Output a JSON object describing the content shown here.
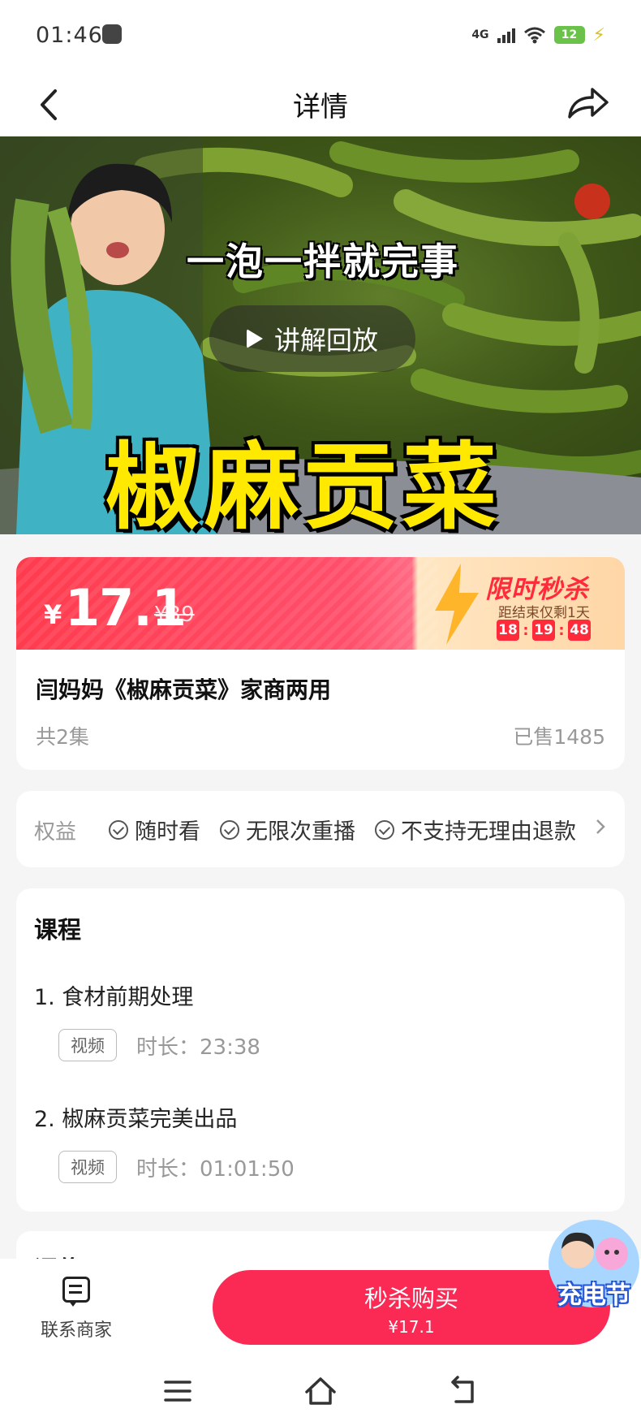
{
  "status_bar": {
    "time": "01:46",
    "network": "4G",
    "battery": "12"
  },
  "nav": {
    "title": "详情"
  },
  "video": {
    "caption": "一泡一拌就完事",
    "title_overlay": "椒麻贡菜",
    "replay_label": "讲解回放"
  },
  "price": {
    "currency": "¥",
    "current": "17.1",
    "original": "¥39",
    "flash_title": "限时秒杀",
    "flash_sub": "距结束仅剩1天",
    "countdown": {
      "h": "18",
      "m": "19",
      "s": "48"
    }
  },
  "product": {
    "title": "闫妈妈《椒麻贡菜》家商两用",
    "episodes": "共2集",
    "sold": "已售1485"
  },
  "benefits": {
    "label": "权益",
    "items": [
      "随时看",
      "无限次重播",
      "不支持无理由退款"
    ]
  },
  "course": {
    "heading": "课程",
    "lessons": [
      {
        "title": "1. 食材前期处理",
        "tag": "视频",
        "duration": "时长：23:38"
      },
      {
        "title": "2. 椒麻贡菜完美出品",
        "tag": "视频",
        "duration": "时长：01:01:50"
      }
    ]
  },
  "review": {
    "heading": "评价"
  },
  "bottom": {
    "contact_label": "联系商家",
    "buy_label": "秒杀购买",
    "buy_price": "¥17.1",
    "promo": "充电节"
  },
  "colors": {
    "accent": "#fa2a55",
    "price_band": "#ff3b4e",
    "flash_red": "#ff2a3a",
    "cover_text": "#ffe900"
  }
}
